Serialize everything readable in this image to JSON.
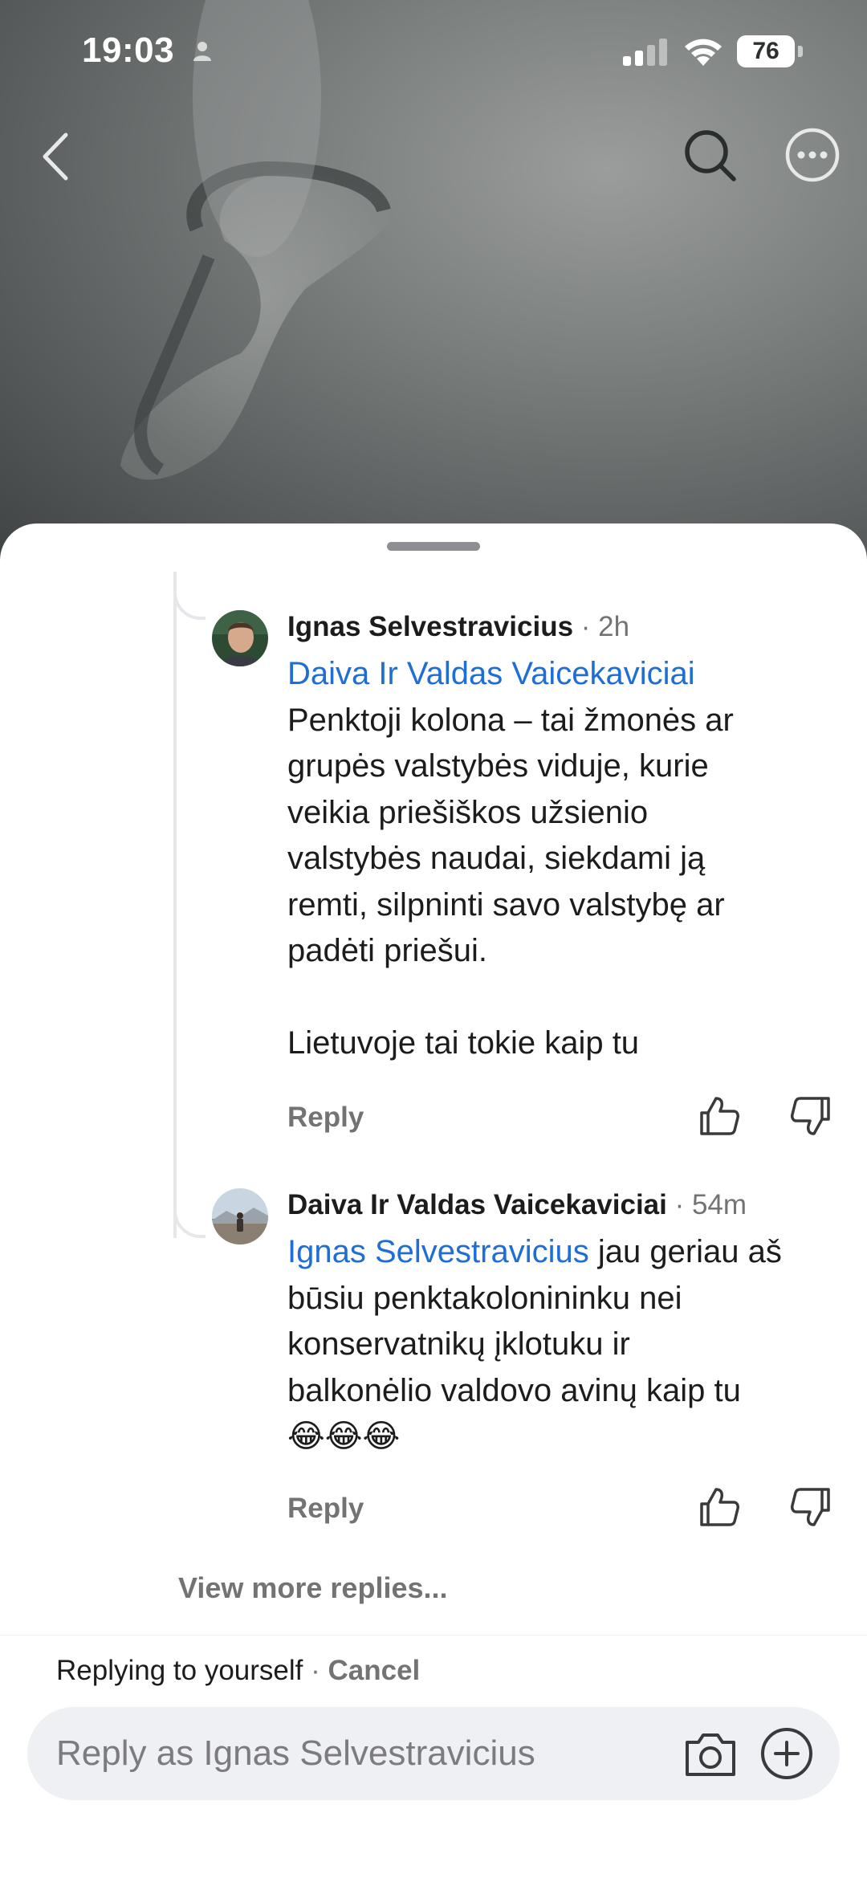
{
  "status_bar": {
    "time": "19:03",
    "battery_level": "76",
    "icons": [
      "person-icon",
      "signal-icon",
      "wifi-icon",
      "battery-icon"
    ]
  },
  "nav": {
    "icons": [
      "back-chevron-icon",
      "search-icon",
      "more-options-icon"
    ]
  },
  "comments": [
    {
      "author": "Ignas Selvestravicius",
      "separator": " · ",
      "time": "2h",
      "mention": "Daiva Ir Valdas Vaicekaviciai",
      "lines": [
        "Penktoji kolona – tai žmonės ar",
        "grupės valstybės viduje, kurie",
        "veikia priešiškos užsienio",
        "valstybės naudai, siekdami ją",
        "remti, silpninti savo valstybę ar",
        "padėti priešui."
      ],
      "closing": "Lietuvoje tai tokie kaip tu",
      "reply_label": "Reply"
    },
    {
      "author": "Daiva Ir Valdas Vaicekaviciai",
      "separator": " · ",
      "time": "54m",
      "mention": "Ignas Selvestravicius",
      "first_line_rest": " jau geriau aš",
      "lines": [
        "būsiu penktakolonininku nei",
        "konservatnikų įklotuku ir",
        "balkonėlio valdovo avinų kaip tu"
      ],
      "emoji": "😂😂😂",
      "reply_label": "Reply"
    }
  ],
  "view_more": "View more replies...",
  "composer": {
    "replying_text": "Replying to yourself",
    "separator": " · ",
    "cancel_label": "Cancel",
    "placeholder": "Reply as Ignas Selvestravicius"
  },
  "colors": {
    "mention": "#1e6ed6",
    "muted": "#737373",
    "input_background": "#eff0f3"
  }
}
